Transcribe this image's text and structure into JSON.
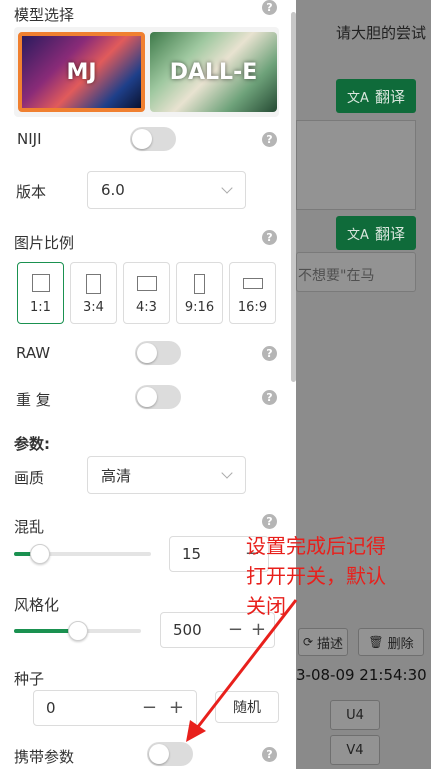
{
  "background": {
    "title": "请大胆的尝试",
    "translate_label": "翻译",
    "placeholder": "不想要\"在马",
    "describe_label": "描述",
    "delete_label": "删除",
    "timestamp": "3-08-09 21:54:30",
    "u4": "U4",
    "v4": "V4"
  },
  "panel": {
    "model_select_label": "模型选择",
    "models": [
      {
        "name": "MJ",
        "selected": true
      },
      {
        "name": "DALL-E",
        "selected": false
      }
    ],
    "niji_label": "NIJI",
    "niji_on": false,
    "version_label": "版本",
    "version_value": "6.0",
    "aspect_label": "图片比例",
    "ratios": [
      {
        "label": "1:1",
        "selected": true
      },
      {
        "label": "3:4",
        "selected": false
      },
      {
        "label": "4:3",
        "selected": false
      },
      {
        "label": "9:16",
        "selected": false
      },
      {
        "label": "16:9",
        "selected": false
      }
    ],
    "raw_label": "RAW",
    "raw_on": false,
    "repeat_label": "重 复",
    "repeat_on": false,
    "params_label": "参数:",
    "quality_label": "画质",
    "quality_value": "高清",
    "chaos_label": "混乱",
    "chaos_value": "15",
    "chaos_fraction": 0.19,
    "stylize_label": "风格化",
    "stylize_value": "500",
    "stylize_fraction": 0.5,
    "seed_label": "种子",
    "seed_value": "0",
    "random_label": "随机",
    "carry_params_label": "携带参数",
    "carry_params_on": false,
    "help_glyph": "?",
    "minus_glyph": "−",
    "plus_glyph": "+"
  },
  "annotation": {
    "text": "设置完成后记得打开开关，默认关闭"
  },
  "colors": {
    "accent": "#1a9150",
    "selected_model_border": "#f08030",
    "annotation": "#e8201c"
  }
}
